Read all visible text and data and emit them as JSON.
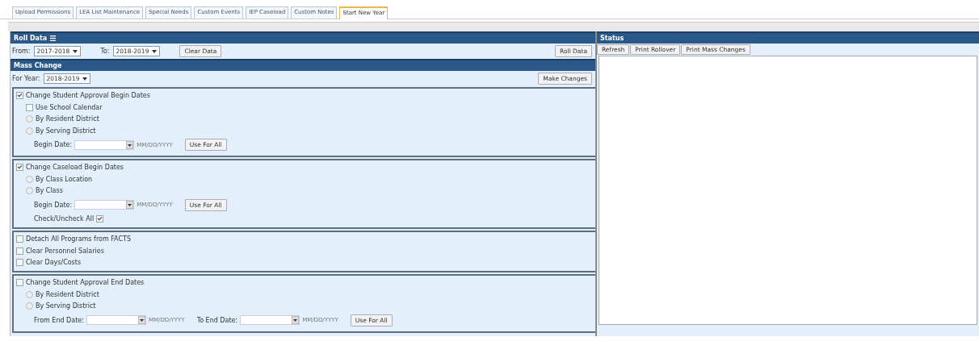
{
  "tabs": [
    {
      "label": "Upload Permissions",
      "selected": false
    },
    {
      "label": "LEA List Maintenance",
      "selected": false
    },
    {
      "label": "Special Needs",
      "selected": false
    },
    {
      "label": "Custom Events",
      "selected": false
    },
    {
      "label": "IEP Caseload",
      "selected": false
    },
    {
      "label": "Custom Notes",
      "selected": false
    },
    {
      "label": "Start New Year",
      "selected": true
    }
  ],
  "roll_data": {
    "title": "Roll Data",
    "from_label": "From:",
    "from_value": "2017-2018",
    "to_label": "To:",
    "to_value": "2018-2019",
    "clear_button": "Clear Data",
    "roll_button": "Roll Data"
  },
  "mass_change": {
    "title": "Mass Change",
    "year_label": "For Year:",
    "year_value": "2018-2019",
    "button": "Make Changes",
    "sections": [
      {
        "label": "Change Student Approval Begin Dates",
        "checked": true,
        "items": [
          {
            "kind": "checkbox",
            "label": "Use School Calendar",
            "checked": false
          },
          {
            "kind": "radio",
            "label": "By Resident District",
            "selected": false
          },
          {
            "kind": "radio",
            "label": "By Serving District",
            "selected": false
          },
          {
            "kind": "date",
            "fields": [
              {
                "label": "Begin Date:",
                "hint": "MM/DD/YYYY"
              }
            ],
            "button": "Use For All"
          }
        ]
      },
      {
        "label": "Change Caseload Begin Dates",
        "checked": true,
        "items": [
          {
            "kind": "radio",
            "label": "By Class Location",
            "selected": false
          },
          {
            "kind": "radio",
            "label": "By Class",
            "selected": false
          },
          {
            "kind": "date",
            "fields": [
              {
                "label": "Begin Date:",
                "hint": "MM/DD/YYYY"
              }
            ],
            "button": "Use For All"
          },
          {
            "kind": "check_all",
            "label": "Check/Uncheck All",
            "checked": true
          }
        ]
      },
      {
        "items": [
          {
            "kind": "flat_checkbox",
            "label": "Detach All Programs from FACTS",
            "checked": false
          },
          {
            "kind": "flat_checkbox",
            "label": "Clear Personnel Salaries",
            "checked": false
          },
          {
            "kind": "flat_checkbox",
            "label": "Clear Days/Costs",
            "checked": false
          }
        ]
      },
      {
        "label": "Change Student Approval End Dates",
        "checked": false,
        "items": [
          {
            "kind": "radio",
            "label": "By Resident District",
            "selected": false
          },
          {
            "kind": "radio",
            "label": "By Serving District",
            "selected": false
          },
          {
            "kind": "date",
            "fields": [
              {
                "label": "From End Date:",
                "hint": "MM/DD/YYYY"
              },
              {
                "label": "To End Date:",
                "hint": "MM/DD/YYYY"
              }
            ],
            "button": "Use For All"
          }
        ]
      }
    ]
  },
  "status": {
    "title": "Status",
    "buttons": [
      "Refresh",
      "Print Rollover",
      "Print Mass Changes"
    ]
  }
}
